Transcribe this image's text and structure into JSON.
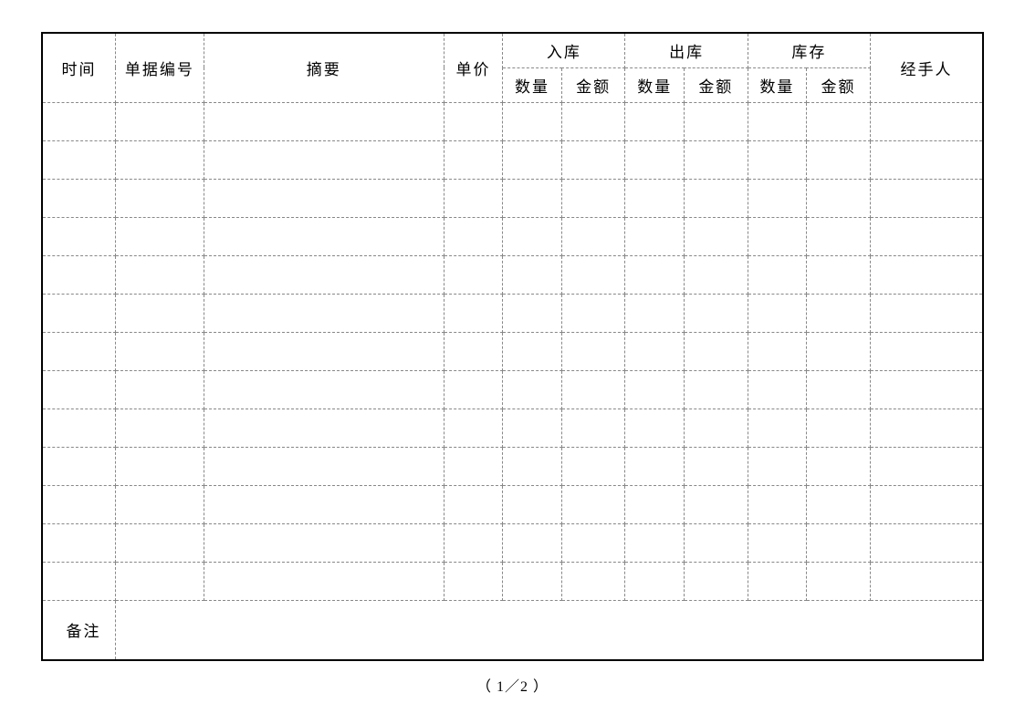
{
  "table": {
    "headers": {
      "time": "时间",
      "doc_number": "单据编号",
      "summary": "摘要",
      "unit_price": "单价",
      "inbound": "入库",
      "outbound": "出库",
      "stock": "库存",
      "handler": "经手人",
      "quantity": "数量",
      "amount": "金额"
    },
    "remarks_label": "备注",
    "body_row_count": 13
  },
  "page_number": "（ 1／2 ）"
}
